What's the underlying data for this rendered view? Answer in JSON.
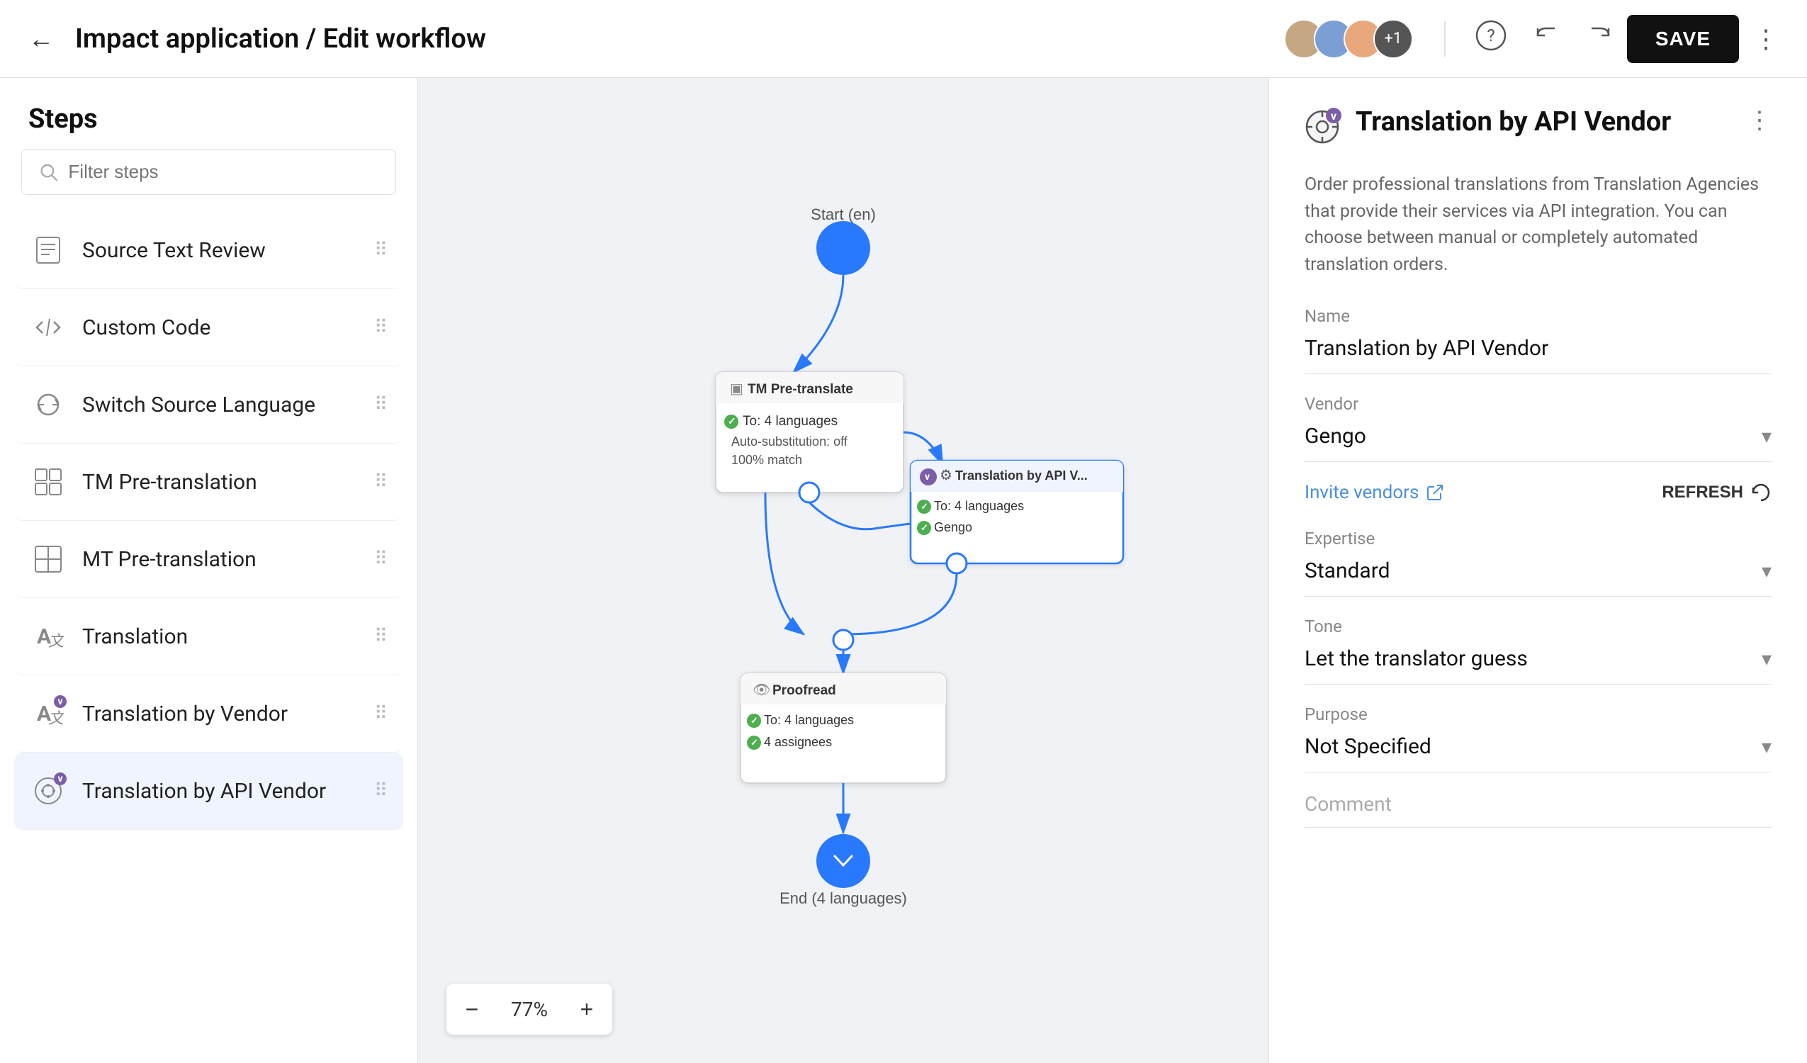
{
  "header": {
    "back_icon": "←",
    "title": "Impact application / Edit workflow",
    "avatar_plus": "+1",
    "help_icon": "?",
    "undo_icon": "↩",
    "redo_icon": "↪",
    "save_label": "SAVE",
    "more_icon": "⋮"
  },
  "sidebar": {
    "title": "Steps",
    "search_placeholder": "Filter steps",
    "steps": [
      {
        "id": "source-text-review",
        "label": "Source Text Review",
        "icon": "≡",
        "badge": null
      },
      {
        "id": "custom-code",
        "label": "Custom Code",
        "icon": "<>",
        "badge": null
      },
      {
        "id": "switch-source-language",
        "label": "Switch Source Language",
        "icon": "⟳",
        "badge": null
      },
      {
        "id": "tm-pretranslation",
        "label": "TM Pre-translation",
        "icon": "▣",
        "badge": null
      },
      {
        "id": "mt-pretranslation",
        "label": "MT Pre-translation",
        "icon": "⊞",
        "badge": null
      },
      {
        "id": "translation",
        "label": "Translation",
        "icon": "A",
        "badge": null
      },
      {
        "id": "translation-by-vendor",
        "label": "Translation by Vendor",
        "icon": "A",
        "badge": "v"
      },
      {
        "id": "translation-by-api-vendor",
        "label": "Translation by API Vendor",
        "icon": "⚙",
        "badge": "v"
      }
    ]
  },
  "canvas": {
    "zoom": "77%",
    "zoom_minus": "−",
    "zoom_plus": "+",
    "nodes": {
      "start": {
        "label": "Start (en)"
      },
      "tm_pre_translate": {
        "label": "TM Pre-translate",
        "to": "To: 4 languages",
        "auto_sub": "Auto-substitution: off",
        "match": "100% match"
      },
      "translation_api": {
        "label": "Translation by API V...",
        "to": "To: 4 languages",
        "vendor": "Gengo"
      },
      "proofread": {
        "label": "Proofread",
        "to": "To: 4 languages",
        "assignees": "4 assignees"
      },
      "end": {
        "label": "End (4 languages)"
      }
    }
  },
  "right_panel": {
    "title": "Translation by API Vendor",
    "icon": "⚙",
    "badge": "v",
    "menu_icon": "⋮",
    "description": "Order professional translations from Translation Agencies that provide their services via API integration. You can choose between manual or completely automated translation orders.",
    "fields": {
      "name": {
        "label": "Name",
        "value": "Translation by API Vendor"
      },
      "vendor": {
        "label": "Vendor",
        "value": "Gengo"
      },
      "invite_vendors_label": "Invite vendors",
      "invite_icon": "↗",
      "refresh_label": "REFRESH",
      "refresh_icon": "↺",
      "expertise": {
        "label": "Expertise",
        "value": "Standard"
      },
      "tone": {
        "label": "Tone",
        "value": "Let the translator guess"
      },
      "purpose": {
        "label": "Purpose",
        "value": "Not Specified"
      },
      "comment": {
        "label": "Comment",
        "placeholder": "Comment"
      }
    }
  }
}
